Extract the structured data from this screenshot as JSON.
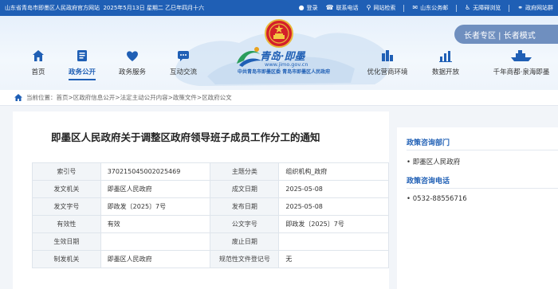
{
  "topbar": {
    "site": "山东省青岛市即墨区人民政府官方网站",
    "date": "2025年5月13日 星期二 乙巳年四月十六",
    "links": [
      {
        "label": "登录",
        "icon": "user-icon"
      },
      {
        "label": "联系电话",
        "icon": "phone-icon"
      },
      {
        "label": "网站检索",
        "icon": "search-icon"
      },
      {
        "label": "山东公务邮",
        "icon": "mail-icon"
      },
      {
        "label": "无障碍浏览",
        "icon": "accessibility-icon"
      },
      {
        "label": "政府网站群",
        "icon": "link-icon"
      }
    ]
  },
  "header": {
    "logo_title": "青岛·即墨",
    "logo_url": "www.jimo.gov.cn",
    "logo_sub": "中共青岛市即墨区委 青岛市即墨区人民政府",
    "elder_mode": "长者专区 | 长者模式",
    "nav": [
      {
        "label": "首页",
        "icon": "home-icon"
      },
      {
        "label": "政务公开",
        "icon": "document-icon",
        "active": true
      },
      {
        "label": "政务服务",
        "icon": "heart-icon"
      },
      {
        "label": "互动交流",
        "icon": "chat-icon"
      },
      {
        "label": "优化营商环境",
        "icon": "building-icon"
      },
      {
        "label": "数据开放",
        "icon": "bar-chart-icon"
      },
      {
        "label": "千年商都·泉海即墨",
        "icon": "ship-icon"
      }
    ]
  },
  "breadcrumb": {
    "prefix": "当前位置：",
    "items": [
      "首页",
      "区政府信息公开",
      "法定主动公开内容",
      "政策文件",
      "区政府公文"
    ],
    "separator": " > "
  },
  "article": {
    "title": "即墨区人民政府关于调整区政府领导班子成员工作分工的通知",
    "meta": [
      [
        {
          "k": "索引号",
          "v": "370215045002025469"
        },
        {
          "k": "主题分类",
          "v": "组织机构_政府"
        }
      ],
      [
        {
          "k": "发文机关",
          "v": "即墨区人民政府"
        },
        {
          "k": "成文日期",
          "v": "2025-05-08"
        }
      ],
      [
        {
          "k": "发文字号",
          "v": "即政发〔2025〕7号"
        },
        {
          "k": "发布日期",
          "v": "2025-05-08"
        }
      ],
      [
        {
          "k": "有效性",
          "v": "有效"
        },
        {
          "k": "公文字号",
          "v": "即政发〔2025〕7号"
        }
      ],
      [
        {
          "k": "生效日期",
          "v": ""
        },
        {
          "k": "废止日期",
          "v": ""
        }
      ],
      [
        {
          "k": "制发机关",
          "v": "即墨区人民政府"
        },
        {
          "k": "规范性文件登记号",
          "v": "无"
        }
      ]
    ]
  },
  "sidebar": {
    "dept_heading": "政策咨询部门",
    "dept_value": "• 即墨区人民政府",
    "phone_heading": "政策咨询电话",
    "phone_value": "• 0532-88556716"
  },
  "colors": {
    "brand": "#1f5fb5",
    "elder_bg": "#6f8fbf"
  }
}
